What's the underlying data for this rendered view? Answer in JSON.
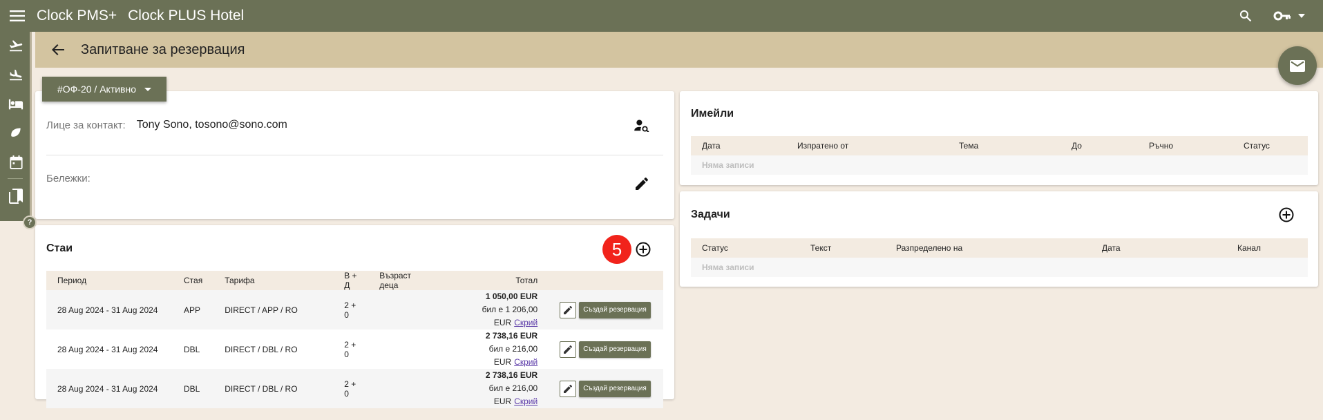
{
  "topbar": {
    "app_name": "Clock PMS+",
    "hotel_name": "Clock PLUS Hotel",
    "icons": [
      "menu-icon",
      "search-icon",
      "key-icon",
      "chevron-down-icon"
    ]
  },
  "sidebar": {
    "items": [
      "flight-takeoff-icon",
      "flight-land-icon",
      "bed-icon",
      "leaf-icon",
      "calendar-icon",
      "bookmarks-icon"
    ],
    "help": "?"
  },
  "header": {
    "title": "Запитване за резервация"
  },
  "status_button": {
    "label": "#ОФ-20 / Активно"
  },
  "contact": {
    "label": "Лице за контакт:",
    "value": "Tony Sono, tosono@sono.com",
    "notes_label": "Бележки:"
  },
  "rooms": {
    "title": "Стаи",
    "count": "5",
    "columns": [
      "Период",
      "Стая",
      "Тарифа",
      "В + Д",
      "Възраст деца",
      "Тотал",
      ""
    ],
    "rows": [
      {
        "period": "28 Aug 2024 - 31 Aug 2024",
        "room": "APP",
        "rate": "DIRECT / APP / RO",
        "guests": "2 + 0",
        "ages": "",
        "total": "1 050,00 EUR",
        "was": "бил е 1 206,00 EUR",
        "hide": "Скрий",
        "create": "Създай резервация"
      },
      {
        "period": "28 Aug 2024 - 31 Aug 2024",
        "room": "DBL",
        "rate": "DIRECT / DBL / RO",
        "guests": "2 + 0",
        "ages": "",
        "total": "2 738,16 EUR",
        "was": "бил е 216,00 EUR",
        "hide": "Скрий",
        "create": "Създай резервация"
      },
      {
        "period": "28 Aug 2024 - 31 Aug 2024",
        "room": "DBL",
        "rate": "DIRECT / DBL / RO",
        "guests": "2 + 0",
        "ages": "",
        "total": "2 738,16 EUR",
        "was": "бил е 216,00 EUR",
        "hide": "Скрий",
        "create": "Създай резервация"
      }
    ]
  },
  "emails": {
    "title": "Имейли",
    "columns": [
      "Дата",
      "Изпратено от",
      "Тема",
      "До",
      "Ръчно",
      "Статус"
    ],
    "empty": "Няма записи"
  },
  "tasks": {
    "title": "Задачи",
    "columns": [
      "Статус",
      "Текст",
      "Разпределено на",
      "Дата",
      "Канал"
    ],
    "empty": "Няма записи"
  },
  "colors": {
    "brand": "#6b7156",
    "header_band": "#d3c4a0",
    "page_bg": "#f3ebe1",
    "badge_red": "#f1231b",
    "link": "#5b3aa8"
  }
}
